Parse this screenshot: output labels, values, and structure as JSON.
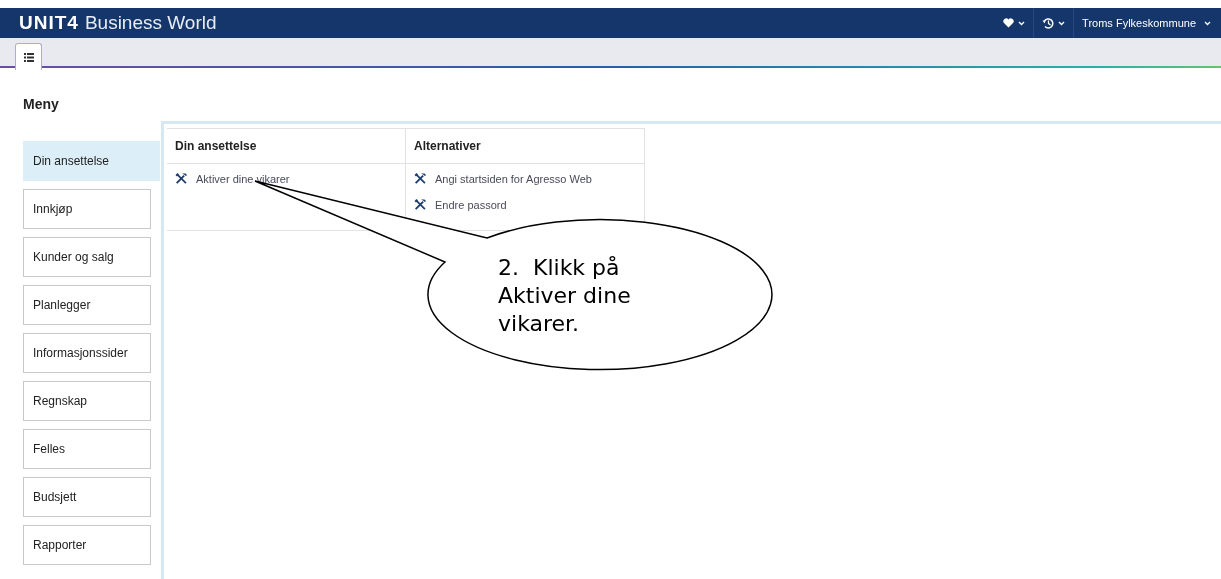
{
  "header": {
    "logo": "UNIT4",
    "product": "Business World",
    "company": "Troms Fylkeskommune"
  },
  "tabs": [
    {
      "kind": "menu",
      "selected": true
    }
  ],
  "menu": {
    "title": "Meny",
    "items": [
      {
        "label": "Din ansettelse",
        "selected": true
      },
      {
        "label": "Innkjøp",
        "selected": false
      },
      {
        "label": "Kunder og salg",
        "selected": false
      },
      {
        "label": "Planlegger",
        "selected": false
      },
      {
        "label": "Informasjonssider",
        "selected": false
      },
      {
        "label": "Regnskap",
        "selected": false
      },
      {
        "label": "Felles",
        "selected": false
      },
      {
        "label": "Budsjett",
        "selected": false
      },
      {
        "label": "Rapporter",
        "selected": false
      }
    ]
  },
  "columns": [
    {
      "title": "Din ansettelse",
      "links": [
        "Aktiver dine vikarer"
      ]
    },
    {
      "title": "Alternativer",
      "links": [
        "Angi startsiden for Agresso Web",
        "Endre passord"
      ]
    }
  ],
  "callout": {
    "text": "2.  Klikk på Aktiver dine vikarer."
  }
}
